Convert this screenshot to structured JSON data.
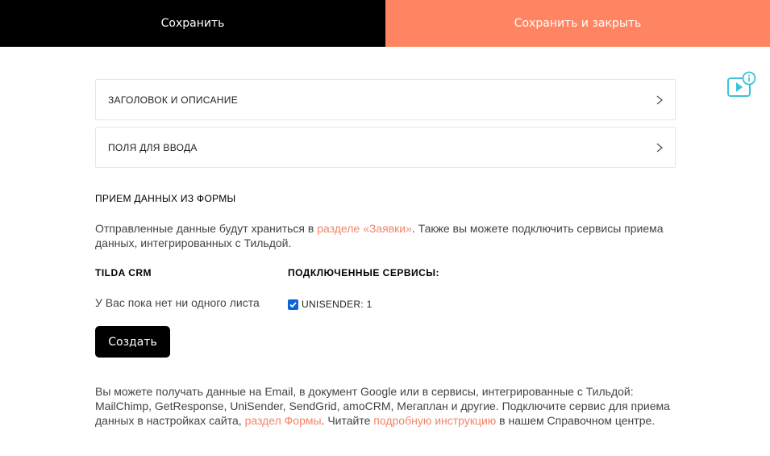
{
  "toolbar": {
    "save_label": "Сохранить",
    "save_close_label": "Сохранить и закрыть",
    "save_color": "#000000",
    "save_close_color": "#ff8562"
  },
  "help": {
    "icon": "video-info-icon",
    "color": "#3cc3d9"
  },
  "panels": [
    {
      "label": "ЗАГОЛОВОК И ОПИСАНИЕ",
      "icon": "chevron-right-icon"
    },
    {
      "label": "ПОЛЯ ДЛЯ ВВОДА",
      "icon": "chevron-right-icon"
    }
  ],
  "section": {
    "title": "ПРИЕМ ДАННЫХ ИЗ ФОРМЫ",
    "desc_before": "Отправленные данные будут храниться в ",
    "desc_link": "разделе «Заявки»",
    "desc_after": ". Также вы можете подключить сервисы приема данных, интегрированных с Тильдой."
  },
  "crm": {
    "title": "TILDA CRM",
    "empty_text": "У Вас пока нет ни одного листа",
    "create_label": "Создать"
  },
  "services": {
    "title": "ПОДКЛЮЧЕННЫЕ СЕРВИСЫ:",
    "items": [
      {
        "label": "UNISENDER: 1",
        "checked": true
      }
    ]
  },
  "footer": {
    "part1": "Вы можете получать данные на Email, в документ Google или в сервисы, интегрированные с Тильдой: MailChimp, GetResponse, UniSender, SendGrid, amoCRM, Мегаплан и другие. Подключите сервис для приема данных в настройках сайта, ",
    "link1": "раздел Формы",
    "part2": ". Читайте ",
    "link2": "подробную инструкцию",
    "part3": " в нашем Справочном центре."
  },
  "colors": {
    "accent": "#ff8562",
    "link": "#f4846a",
    "checkbox": "#0a66d8"
  }
}
